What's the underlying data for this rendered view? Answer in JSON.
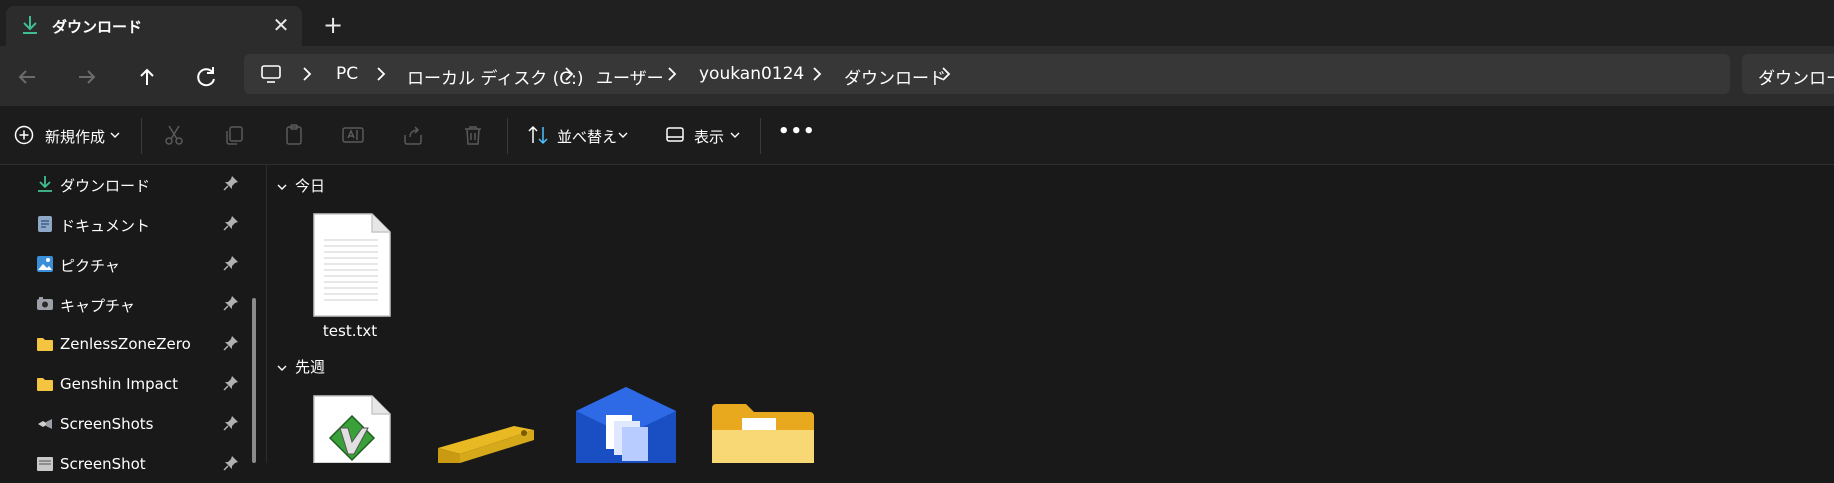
{
  "tab": {
    "title": "ダウンロード",
    "close": "✕"
  },
  "new_tab": "+",
  "breadcrumb": [
    "PC",
    "ローカル ディスク (C:)",
    "ユーザー",
    "youkan0124",
    "ダウンロード"
  ],
  "search": {
    "placeholder": "ダウンロード"
  },
  "toolbar": {
    "new_label": "新規作成",
    "sort_label": "並べ替え",
    "view_label": "表示",
    "more_label": "•••"
  },
  "sidebar": {
    "items": [
      {
        "label": "ダウンロード",
        "icon": "download-icon"
      },
      {
        "label": "ドキュメント",
        "icon": "document-icon"
      },
      {
        "label": "ピクチャ",
        "icon": "picture-icon"
      },
      {
        "label": "キャプチャ",
        "icon": "capture-icon"
      },
      {
        "label": "ZenlessZoneZero",
        "icon": "folder-icon"
      },
      {
        "label": "Genshin Impact",
        "icon": "folder-icon"
      },
      {
        "label": "ScreenShots",
        "icon": "screenshots-icon"
      },
      {
        "label": "ScreenShot",
        "icon": "screenshot-icon"
      }
    ]
  },
  "groups": {
    "today": {
      "label": "今日",
      "files": [
        {
          "name": "test.txt",
          "icon": "text-file-icon"
        }
      ]
    },
    "last_week": {
      "label": "先週"
    }
  },
  "colors": {
    "accent": "#4cc2ff",
    "download_green": "#3fbf8f",
    "folder_yellow": "#f5c542"
  }
}
